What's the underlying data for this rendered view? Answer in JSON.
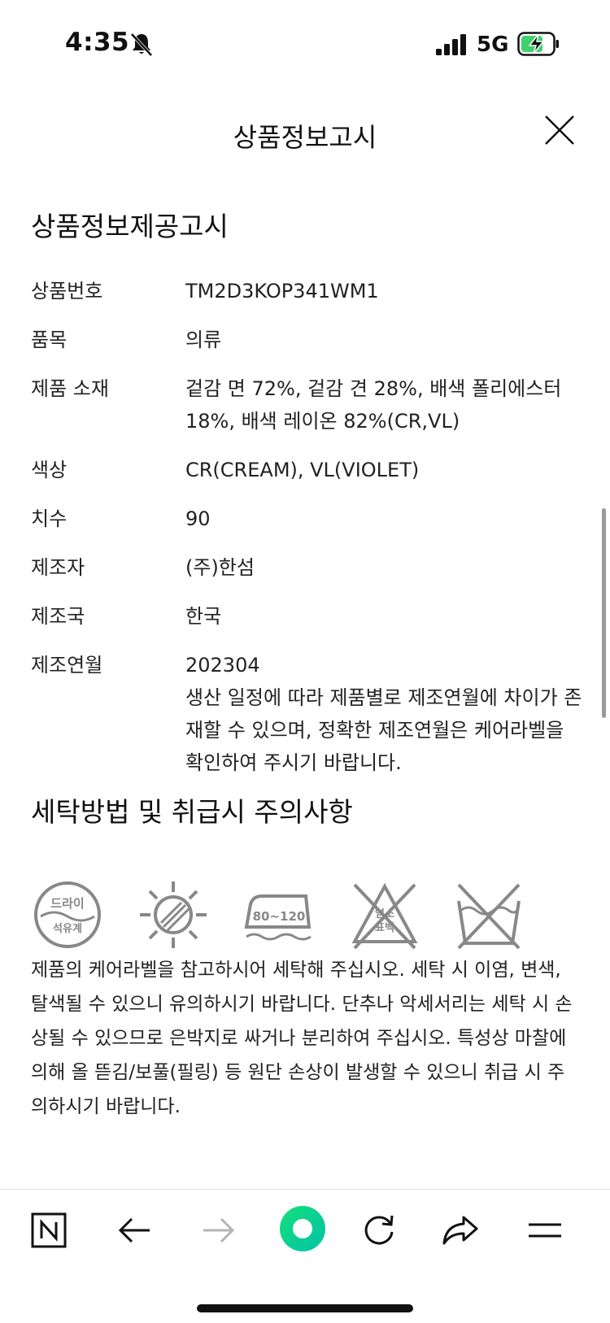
{
  "status_bar": {
    "time": "4:35",
    "network": "5G"
  },
  "header": {
    "title": "상품정보고시"
  },
  "product_info": {
    "section_title": "상품정보제공고시",
    "rows": [
      {
        "label": "상품번호",
        "value": "TM2D3KOP341WM1"
      },
      {
        "label": "품목",
        "value": "의류"
      },
      {
        "label": "제품 소재",
        "value": "겉감 면 72%, 겉감 견 28%, 배색 폴리에스터 18%, 배색 레이온 82%(CR,VL)"
      },
      {
        "label": "색상",
        "value": "CR(CREAM), VL(VIOLET)"
      },
      {
        "label": "치수",
        "value": "90"
      },
      {
        "label": "제조자",
        "value": "(주)한섬"
      },
      {
        "label": "제조국",
        "value": "한국"
      },
      {
        "label": "제조연월",
        "value": "202304",
        "note": "생산 일정에 따라 제품별로 제조연월에 차이가 존재할 수 있으며, 정확한 제조연월은 케어라벨을 확인하여 주시기 바랍니다."
      }
    ]
  },
  "care": {
    "section_title": "세탁방법 및 취급시 주의사항",
    "icons": [
      {
        "name": "dry-clean-icon",
        "text_top": "드라이",
        "text_bottom": "석유계"
      },
      {
        "name": "no-sun-dry-icon"
      },
      {
        "name": "iron-icon",
        "text": "80~120"
      },
      {
        "name": "no-bleach-icon",
        "text_top": "염소",
        "text_bottom": "표백"
      },
      {
        "name": "no-wash-icon"
      }
    ],
    "text": "제품의 케어라벨을 참고하시어 세탁해 주십시오. 세탁 시 이염, 변색, 탈색될 수 있으니 유의하시기 바랍니다. 단추나 악세서리는 세탁 시 손상될 수 있으므로 은박지로 싸거나 분리하여 주십시오. 특성상 마찰에 의해 올 뜯김/보풀(필링) 등 원단 손상이 발생할 수 있으니 취급 시 주의하시기 바랍니다."
  },
  "bottom_nav": {
    "buttons": [
      "naver-home-icon",
      "back-arrow-icon",
      "forward-arrow-icon",
      "green-dot-icon",
      "refresh-icon",
      "share-icon",
      "menu-icon"
    ],
    "accent_color": "#03c75a"
  }
}
